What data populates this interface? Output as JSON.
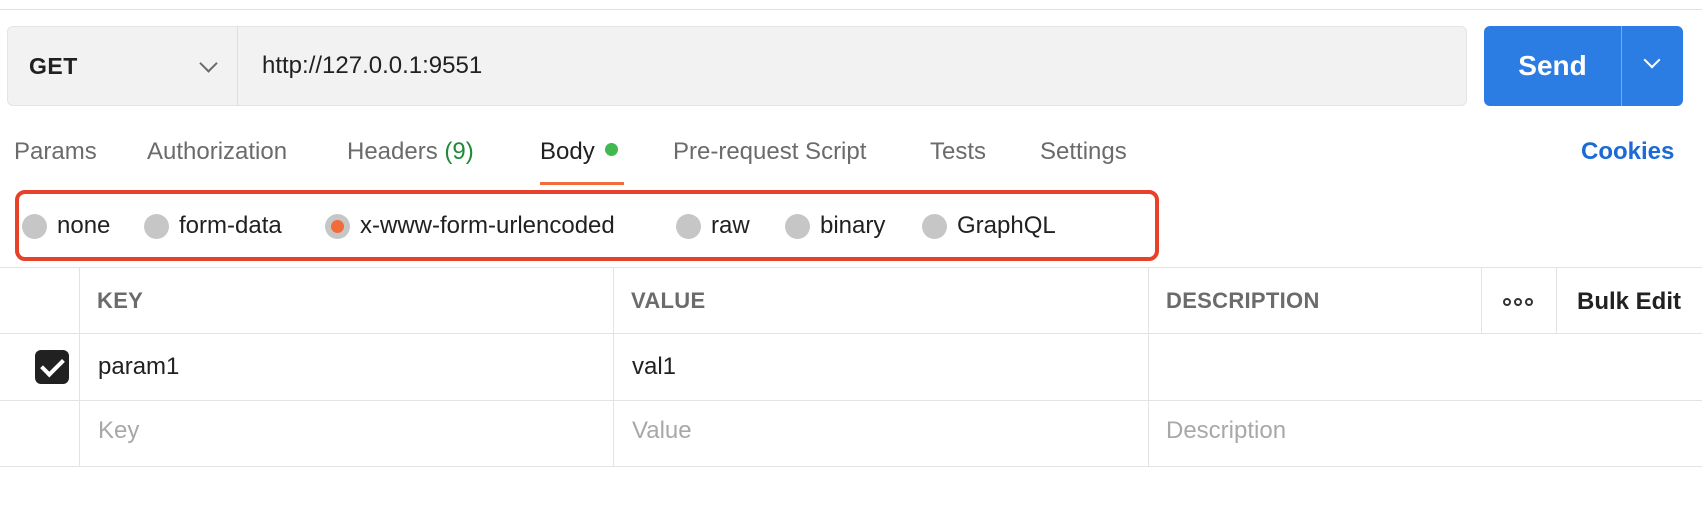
{
  "request": {
    "method": "GET",
    "url": "http://127.0.0.1:9551",
    "send_label": "Send"
  },
  "tabs": [
    {
      "label": "Params"
    },
    {
      "label": "Authorization"
    },
    {
      "label": "Headers",
      "count": "(9)"
    },
    {
      "label": "Body",
      "active": true
    },
    {
      "label": "Pre-request Script"
    },
    {
      "label": "Tests"
    },
    {
      "label": "Settings"
    }
  ],
  "cookies_label": "Cookies",
  "body_types": [
    {
      "label": "none",
      "checked": false
    },
    {
      "label": "form-data",
      "checked": false
    },
    {
      "label": "x-www-form-urlencoded",
      "checked": true
    },
    {
      "label": "raw",
      "checked": false
    },
    {
      "label": "binary",
      "checked": false
    },
    {
      "label": "GraphQL",
      "checked": false
    }
  ],
  "table": {
    "headers": {
      "key": "KEY",
      "value": "VALUE",
      "description": "DESCRIPTION"
    },
    "bulk_edit_label": "Bulk Edit",
    "rows": [
      {
        "checked": true,
        "key": "param1",
        "value": "val1",
        "description": ""
      }
    ],
    "placeholders": {
      "key": "Key",
      "value": "Value",
      "description": "Description"
    }
  },
  "colors": {
    "accent": "#f26b3a",
    "send_button": "#2b7de3",
    "cookies_link": "#1b6ad6",
    "highlight_box": "#e8412a",
    "body_dot": "#3fb950"
  }
}
